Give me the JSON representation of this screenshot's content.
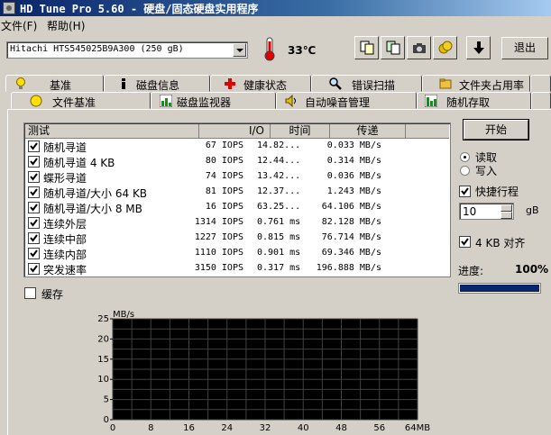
{
  "window": {
    "title": "HD Tune Pro 5.60 - 硬盘/固态硬盘实用程序"
  },
  "menu": [
    "文件(F)",
    "帮助(H)"
  ],
  "toolbar": {
    "drive": "Hitachi HTS545025B9A300 (250 gB)",
    "temperature": "33℃",
    "exit_label": "退出",
    "icons": [
      "copy-icon",
      "copy-alt-icon",
      "camera-icon",
      "health-coins-icon",
      "download-icon"
    ]
  },
  "tabs_row1": [
    "基准",
    "磁盘信息",
    "健康状态",
    "错误扫描",
    "文件夹占用率"
  ],
  "tabs_row2": [
    "文件基准",
    "磁盘监视器",
    "自动噪音管理",
    "随机存取"
  ],
  "table": {
    "headers": [
      "测试",
      "I/O",
      "时间",
      "传递"
    ],
    "rows": [
      {
        "name": "随机寻道",
        "io": "67 IOPS",
        "time": "14.82...",
        "rate": "0.033 MB/s"
      },
      {
        "name": "随机寻道 4 KB",
        "io": "80 IOPS",
        "time": "12.44...",
        "rate": "0.314 MB/s"
      },
      {
        "name": "蝶形寻道",
        "io": "74 IOPS",
        "time": "13.42...",
        "rate": "0.036 MB/s"
      },
      {
        "name": "随机寻道/大小 64 KB",
        "io": "81 IOPS",
        "time": "12.37...",
        "rate": "1.243 MB/s"
      },
      {
        "name": "随机寻道/大小 8 MB",
        "io": "16 IOPS",
        "time": "63.25...",
        "rate": "64.106 MB/s"
      },
      {
        "name": "连续外层",
        "io": "1314 IOPS",
        "time": "0.761 ms",
        "rate": "82.128 MB/s"
      },
      {
        "name": "连续中部",
        "io": "1227 IOPS",
        "time": "0.815 ms",
        "rate": "76.714 MB/s"
      },
      {
        "name": "连续内部",
        "io": "1110 IOPS",
        "time": "0.901 ms",
        "rate": "69.346 MB/s"
      },
      {
        "name": "突发速率",
        "io": "3150 IOPS",
        "time": "0.317 ms",
        "rate": "196.888 MB/s"
      }
    ]
  },
  "controls": {
    "start_label": "开始",
    "read_label": "读取",
    "write_label": "写入",
    "short_stroke_label": "快捷行程",
    "short_stroke_value": "10",
    "short_stroke_unit": "gB",
    "align_label": "4 KB 对齐",
    "progress_label": "进度:",
    "progress_text": "100%",
    "progress": 1.0,
    "cache_label": "缓存"
  },
  "chart_data": {
    "type": "line",
    "ylabel": "MB/s",
    "xlabel": "",
    "ylim": [
      0,
      25
    ],
    "xlim": [
      0,
      64
    ],
    "yticks": [
      "0",
      "5",
      "10",
      "15",
      "20",
      "25"
    ],
    "xticks": [
      "0",
      "8",
      "16",
      "24",
      "32",
      "40",
      "48",
      "56",
      "64MB"
    ],
    "series": [],
    "grid": true
  },
  "colors": {
    "chart_bg": "#000000",
    "grid": "#404040",
    "progress": "#0a246a",
    "title_start": "#0a246a"
  }
}
